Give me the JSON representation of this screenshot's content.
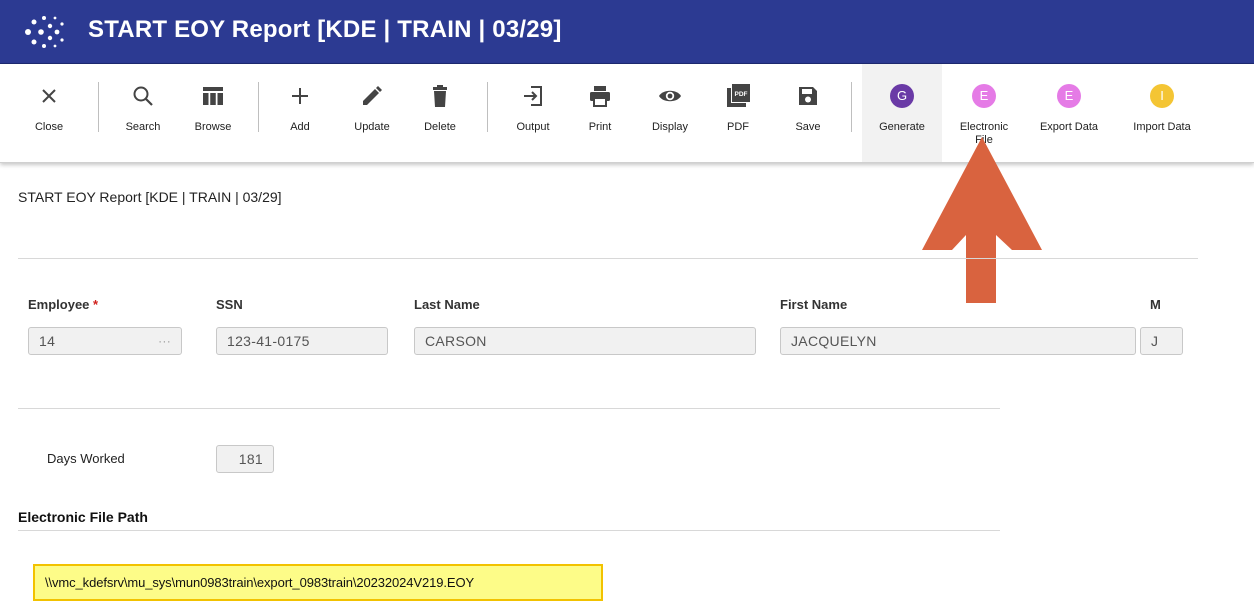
{
  "window": {
    "title": "START EOY Report [KDE | TRAIN | 03/29]"
  },
  "toolbar": {
    "buttons": [
      {
        "label": "Close",
        "icon": "close-icon"
      },
      {
        "label": "Search",
        "icon": "search-icon"
      },
      {
        "label": "Browse",
        "icon": "browse-icon"
      },
      {
        "label": "Add",
        "icon": "plus-icon"
      },
      {
        "label": "Update",
        "icon": "pencil-icon"
      },
      {
        "label": "Delete",
        "icon": "trash-icon"
      },
      {
        "label": "Output",
        "icon": "output-icon"
      },
      {
        "label": "Print",
        "icon": "printer-icon"
      },
      {
        "label": "Display",
        "icon": "eye-icon"
      },
      {
        "label": "PDF",
        "icon": "pdf-icon"
      },
      {
        "label": "Save",
        "icon": "save-icon"
      },
      {
        "label": "Generate",
        "icon": "letter-g-icon",
        "letter": "G",
        "color": "#6a3aa6"
      },
      {
        "label": "Electronic File",
        "icon": "letter-e-icon",
        "letter": "E",
        "color": "#e57be6"
      },
      {
        "label": "Export Data",
        "icon": "letter-e-icon",
        "letter": "E",
        "color": "#e57be6"
      },
      {
        "label": "Import Data",
        "icon": "letter-i-icon",
        "letter": "I",
        "color": "#f4c534"
      }
    ]
  },
  "page": {
    "title": "START EOY Report [KDE | TRAIN | 03/29]"
  },
  "employee": {
    "employee_label": "Employee",
    "required_mark": "*",
    "employee_value": "14",
    "lookup_ellipsis": "···",
    "ssn_label": "SSN",
    "ssn_value": "123-41-0175",
    "last_name_label": "Last Name",
    "last_name_value": "CARSON",
    "first_name_label": "First Name",
    "first_name_value": "JACQUELYN",
    "middle_label": "M",
    "middle_value": "J"
  },
  "days": {
    "label": "Days Worked",
    "value": "181"
  },
  "electronic_file": {
    "section_title": "Electronic File Path",
    "path": "\\\\vmc_kdefsrv\\mu_sys\\mun0983train\\export_0983train\\20232024V219.EOY"
  },
  "colors": {
    "titlebar": "#2c3a92",
    "arrow": "#d9633f",
    "highlight_fill": "#fdfc88",
    "highlight_border": "#f2c200"
  }
}
